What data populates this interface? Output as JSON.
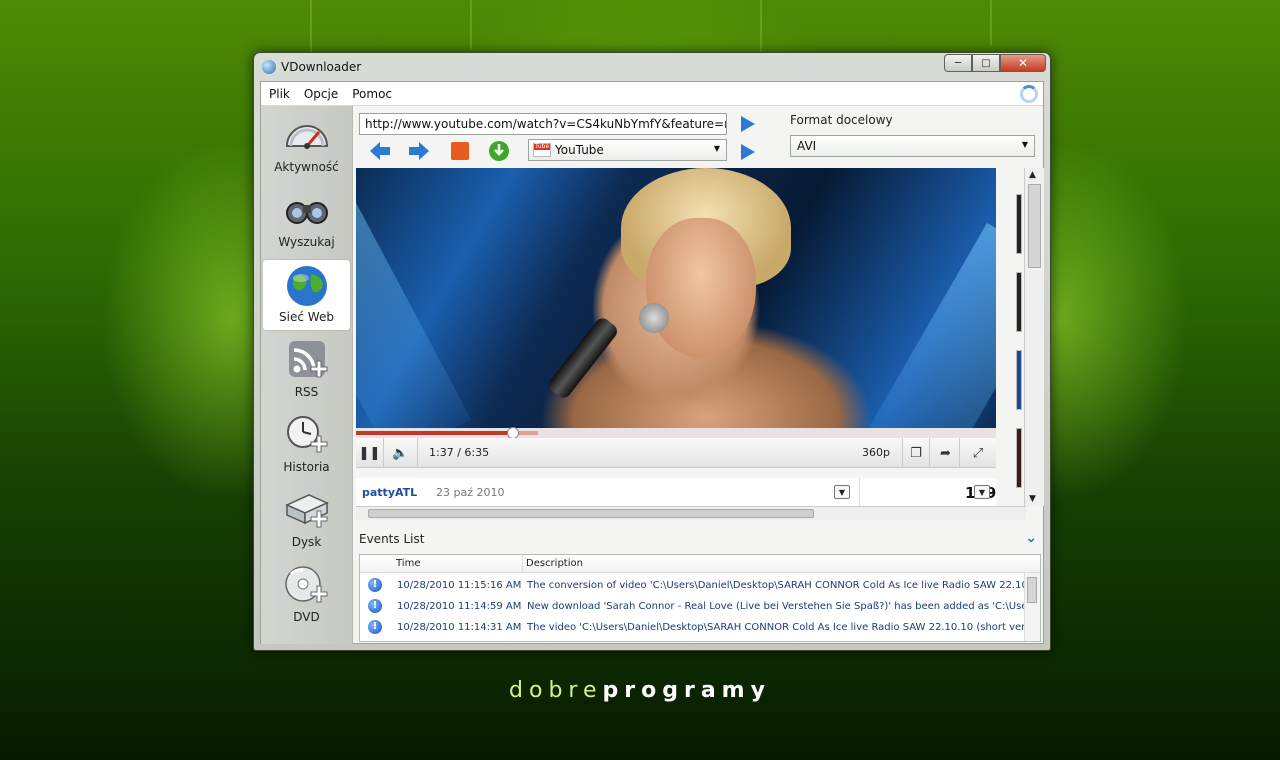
{
  "window": {
    "title": "VDownloader"
  },
  "menu": [
    "Plik",
    "Opcje",
    "Pomoc"
  ],
  "sidebar": {
    "items": [
      {
        "label": "Aktywność",
        "icon": "speedometer-icon"
      },
      {
        "label": "Wyszukaj",
        "icon": "binoculars-icon"
      },
      {
        "label": "Sieć Web",
        "icon": "globe-icon",
        "active": true
      },
      {
        "label": "RSS",
        "icon": "rss-add-icon"
      },
      {
        "label": "Historia",
        "icon": "clock-add-icon"
      },
      {
        "label": "Dysk",
        "icon": "disk-add-icon"
      },
      {
        "label": "DVD",
        "icon": "dvd-add-icon"
      }
    ]
  },
  "toolbar": {
    "url": "http://www.youtube.com/watch?v=CS4kuNbYmfY&feature=related",
    "format_label": "Format docelowy",
    "format_value": "AVI",
    "site_value": "YouTube"
  },
  "player": {
    "time": "1:37 / 6:35",
    "quality": "360p",
    "progress": 0.245,
    "buffered": 0.285
  },
  "comment": {
    "user": "pattyATL",
    "date": "23 paź 2010",
    "views": "16950"
  },
  "events": {
    "title": "Events List",
    "columns": [
      "Time",
      "Description"
    ],
    "rows": [
      {
        "time": "10/28/2010 11:15:16 AM",
        "desc": "The conversion of video 'C:\\Users\\Daniel\\Desktop\\SARAH CONNOR  Cold As Ice   live Radio SAW 22.10.10 (shor"
      },
      {
        "time": "10/28/2010 11:14:59 AM",
        "desc": "New download 'Sarah Connor - Real Love (Live bei Verstehen Sie Spaß?)' has been added as 'C:\\Users\\Daniel\\De"
      },
      {
        "time": "10/28/2010 11:14:31 AM",
        "desc": "The video 'C:\\Users\\Daniel\\Desktop\\SARAH CONNOR  Cold As Ice   live Radio SAW 22.10.10 (short version).avi' !"
      }
    ]
  },
  "brand": {
    "light": "dobre",
    "bold": "programy"
  },
  "colors": {
    "accent": "#2a6bc4",
    "progress": "#c0392b",
    "background": "#2f6a03"
  }
}
